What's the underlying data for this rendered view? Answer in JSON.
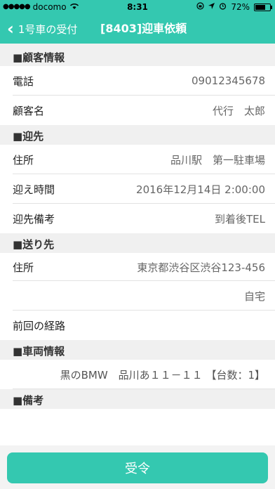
{
  "status_bar": {
    "carrier": "docomo",
    "time": "8:31",
    "battery_percent": "72%",
    "battery_level": 0.72
  },
  "nav": {
    "back_label": "1号車の受付",
    "title": "[8403]迎車依頼"
  },
  "sections": {
    "customer": {
      "header": "■顧客情報",
      "phone_label": "電話",
      "phone_value": "09012345678",
      "name_label": "顧客名",
      "name_value": "代行　太郎"
    },
    "pickup": {
      "header": "■迎先",
      "address_label": "住所",
      "address_value": "品川駅　第一駐車場",
      "time_label": "迎え時間",
      "time_value": "2016年12月14日 2:00:00",
      "note_label": "迎先備考",
      "note_value": "到着後TEL"
    },
    "destination": {
      "header": "■送り先",
      "address_label": "住所",
      "address_value": "東京都渋谷区渋谷123-456",
      "address_extra": "自宅",
      "route_label": "前回の経路"
    },
    "vehicle": {
      "header": "■車両情報",
      "info": "黒のBMW　品川あ１１－１１ 【台数：1】"
    },
    "memo": {
      "header": "■備考"
    }
  },
  "footer": {
    "accept_label": "受令"
  }
}
